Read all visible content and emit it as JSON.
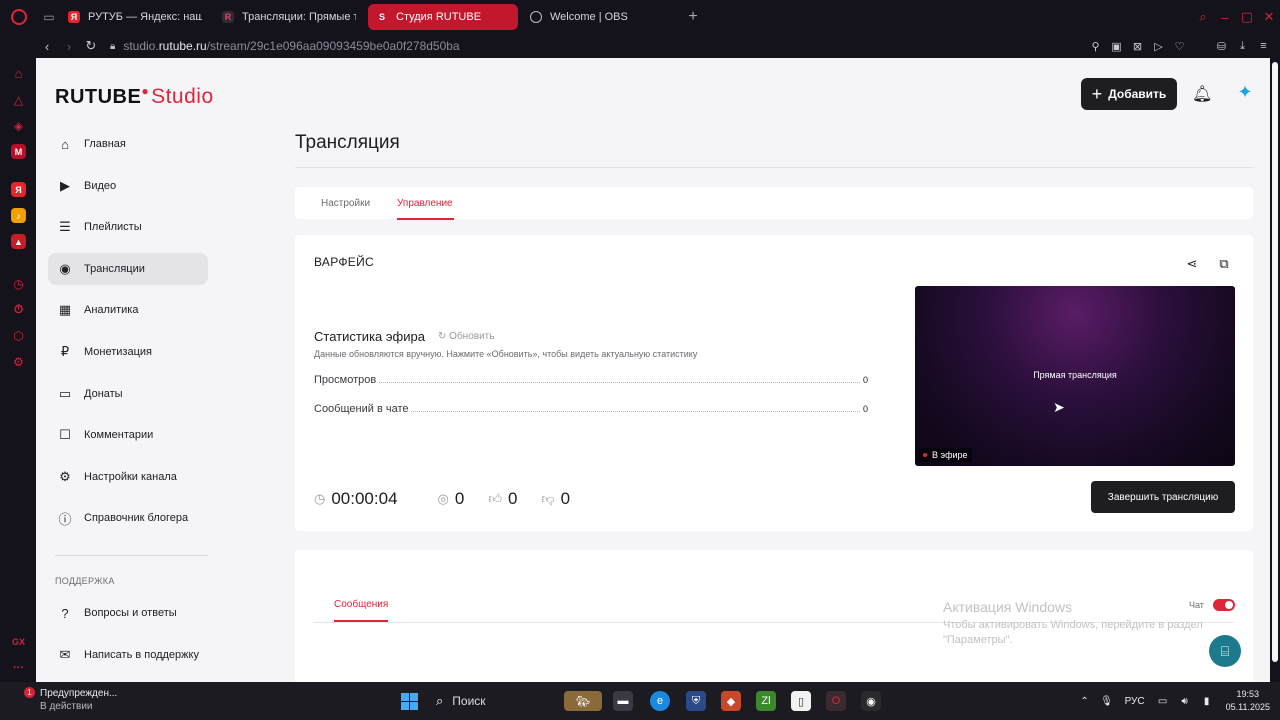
{
  "browser": {
    "tabs": [
      {
        "label": "РУТУБ — Яндекс: нашло",
        "favicon": "yandex-icon",
        "active": false
      },
      {
        "label": "Трансляции: Прямые тр",
        "favicon": "rutube-icon",
        "active": false
      },
      {
        "label": "Студия RUTUBE",
        "favicon": "studio-icon",
        "active": true
      },
      {
        "label": "Welcome | OBS",
        "favicon": "obs-icon",
        "active": false
      }
    ],
    "url_prefix": "studio.",
    "url_host": "rutube.ru",
    "url_path": "/stream/29c1e096aa09093459be0a0f278d50ba"
  },
  "header": {
    "logo_brand": "RUTUBE",
    "logo_studio": "Studio",
    "add_label": "Добавить"
  },
  "nav": {
    "items": [
      {
        "label": "Главная",
        "icon": "home-icon"
      },
      {
        "label": "Видео",
        "icon": "video-icon"
      },
      {
        "label": "Плейлисты",
        "icon": "playlist-icon"
      },
      {
        "label": "Трансляции",
        "icon": "broadcast-icon"
      },
      {
        "label": "Аналитика",
        "icon": "analytics-icon"
      },
      {
        "label": "Монетизация",
        "icon": "ruble-icon"
      },
      {
        "label": "Донаты",
        "icon": "wallet-icon"
      },
      {
        "label": "Комментарии",
        "icon": "comment-icon"
      },
      {
        "label": "Настройки канала",
        "icon": "gear-icon"
      },
      {
        "label": "Справочник блогера",
        "icon": "info-icon"
      }
    ],
    "support_title": "ПОДДЕРЖКА",
    "support_items": [
      {
        "label": "Вопросы и ответы",
        "icon": "question-icon"
      },
      {
        "label": "Написать в поддержку",
        "icon": "mail-icon"
      }
    ]
  },
  "page": {
    "title": "Трансляция",
    "tabs": [
      "Настройки",
      "Управление"
    ],
    "active_tab": "Управление"
  },
  "stream": {
    "name": "ВАРФЕЙС",
    "stats_title": "Статистика эфира",
    "refresh_label": "Обновить",
    "stats_desc": "Данные обновляются вручную. Нажмите «Обновить», чтобы видеть актуальную статистику",
    "stats": [
      {
        "label": "Просмотров",
        "value": "0"
      },
      {
        "label": "Сообщений в чате",
        "value": "0"
      }
    ],
    "duration": "00:00:04",
    "viewers": "0",
    "likes": "0",
    "dislikes": "0",
    "preview_label": "Прямая трансляция",
    "live_badge": "В эфире",
    "end_label": "Завершить трансляцию"
  },
  "chat": {
    "tab_label": "Сообщения",
    "toggle_label": "Чат",
    "enabled": true
  },
  "overlay": {
    "activate_title": "Активация Windows",
    "activate_line1": "Чтобы активировать Windows, перейдите в раздел",
    "activate_line2": "\"Параметры\"."
  },
  "taskbar": {
    "notify_title": "Предупрежден...",
    "notify_sub": "В действии",
    "notify_count": "1",
    "search_label": "Поиск",
    "lang": "РУС",
    "time": "19:53",
    "date": "05.11.2025"
  },
  "colors": {
    "accent": "#e0243a",
    "dark_button": "#1d1d22",
    "page_bg": "#f5f5f7"
  }
}
